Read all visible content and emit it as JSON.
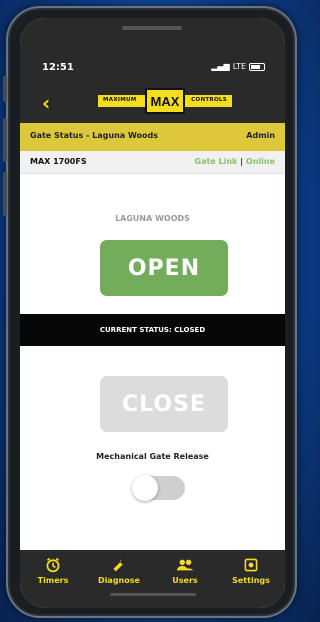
{
  "status_bar": {
    "time": "12:51",
    "network": "LTE"
  },
  "header": {
    "back_label": "‹",
    "logo": {
      "left": "MAXIMUM",
      "center": "MAX",
      "right": "CONTROLS"
    }
  },
  "gate_bar": {
    "title": "Gate Status - Laguna Woods",
    "role": "Admin"
  },
  "model_bar": {
    "model": "MAX 1700FS",
    "link": "Gate Link",
    "separator": "|",
    "connection": "Online"
  },
  "main": {
    "site_name": "LAGUNA WOODS",
    "open_label": "OPEN",
    "current_status": "CURRENT STATUS: CLOSED",
    "close_label": "CLOSE",
    "release_label": "Mechanical Gate Release",
    "release_enabled": false
  },
  "tabs": [
    {
      "label": "Timers",
      "icon": "clock-icon"
    },
    {
      "label": "Diagnose",
      "icon": "wrench-icon"
    },
    {
      "label": "Users",
      "icon": "users-icon"
    },
    {
      "label": "Settings",
      "icon": "settings-icon"
    }
  ],
  "colors": {
    "accent": "#f4dc1e",
    "gate_bar": "#dcc83a",
    "open_button": "#73ad5b",
    "close_button_disabled": "#dcdcdc",
    "online": "#8bbf6a",
    "dark": "#2a2a2a"
  }
}
